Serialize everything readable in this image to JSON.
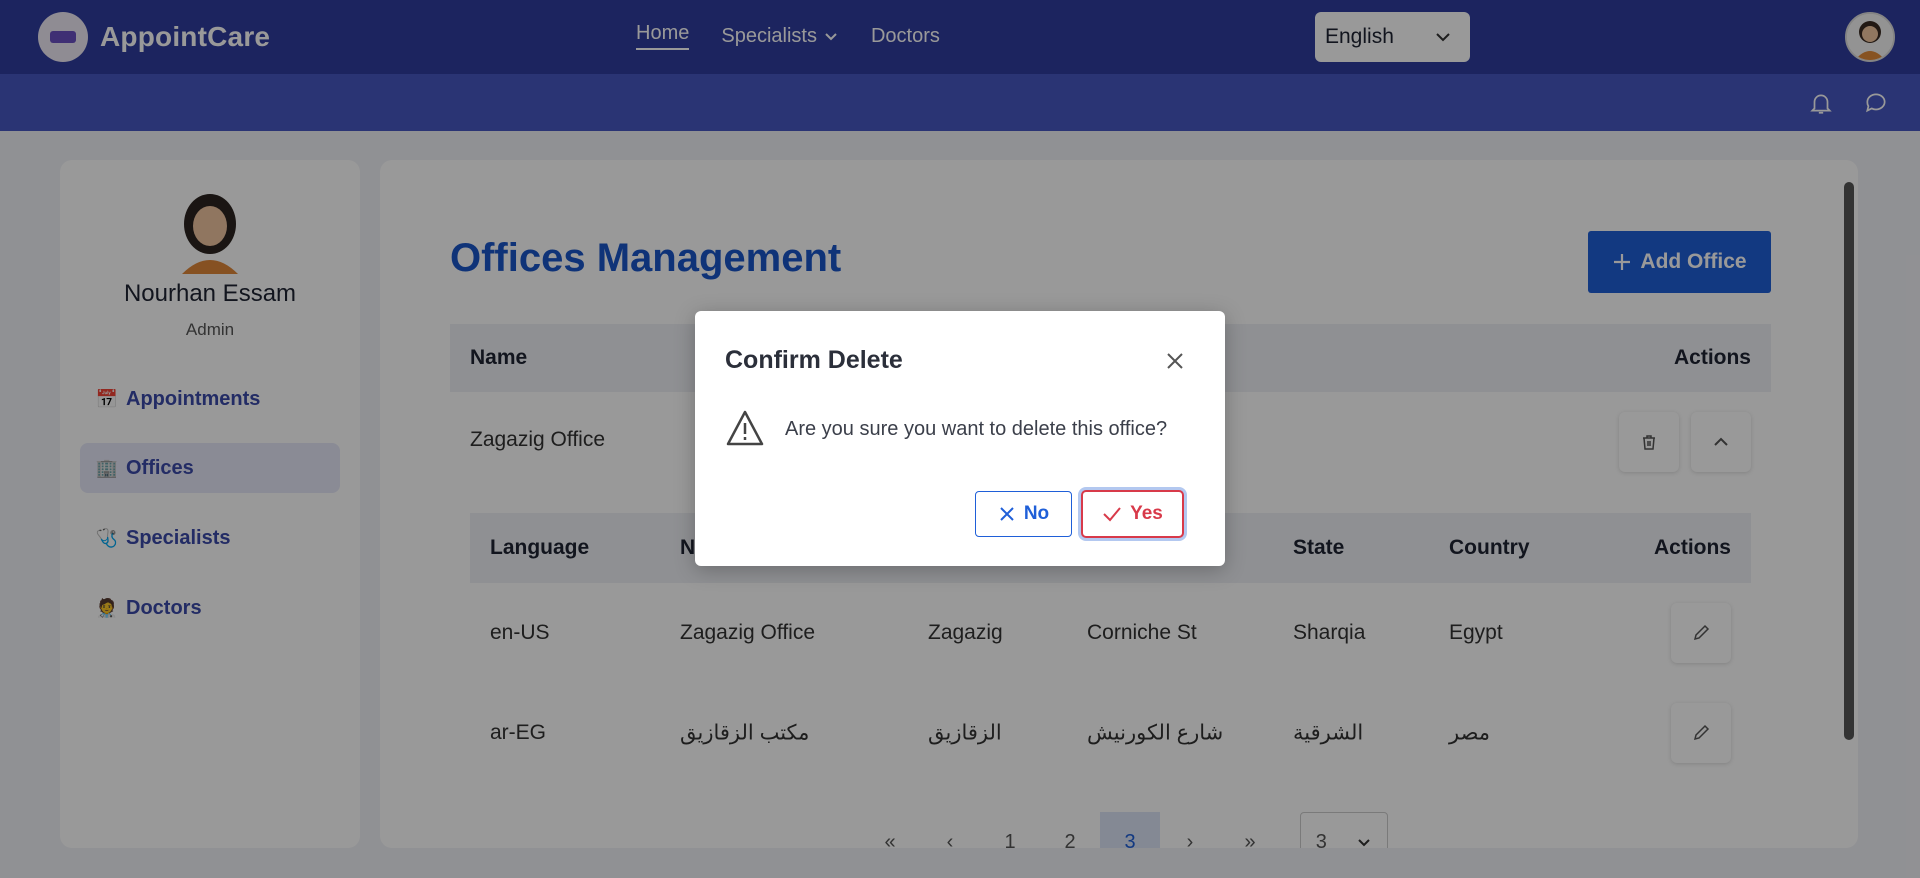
{
  "app": {
    "name": "AppointCare"
  },
  "nav": {
    "items": [
      {
        "label": "Home"
      },
      {
        "label": "Specialists"
      },
      {
        "label": "Doctors"
      }
    ]
  },
  "language": {
    "selected": "English"
  },
  "profile": {
    "name": "Nourhan Essam",
    "role": "Admin"
  },
  "sidebar": {
    "items": [
      {
        "label": "Appointments",
        "icon": "calendar-icon"
      },
      {
        "label": "Offices",
        "icon": "building-icon"
      },
      {
        "label": "Specialists",
        "icon": "stethoscope-icon"
      },
      {
        "label": "Doctors",
        "icon": "doctor-icon"
      }
    ]
  },
  "page": {
    "title": "Offices Management",
    "add_label": "Add Office"
  },
  "table": {
    "headers": {
      "name": "Name",
      "actions": "Actions"
    },
    "row": {
      "name": "Zagazig Office"
    }
  },
  "inner_table": {
    "headers": {
      "language": "Language",
      "name": "N",
      "state": "State",
      "country": "Country",
      "actions": "Actions"
    },
    "rows": [
      {
        "language": "en-US",
        "name": "Zagazig Office",
        "city": "Zagazig",
        "street": "Corniche St",
        "state": "Sharqia",
        "country": "Egypt"
      },
      {
        "language": "ar-EG",
        "name": "مكتب الزقازيق",
        "city": "الزقازيق",
        "street": "شارع الكورنيش",
        "state": "الشرقية",
        "country": "مصر"
      }
    ]
  },
  "pagination": {
    "first": "«",
    "prev": "‹",
    "pages": [
      "1",
      "2",
      "3"
    ],
    "current": "3",
    "next": "›",
    "last": "»",
    "page_size": "3"
  },
  "dialog": {
    "title": "Confirm Delete",
    "message": "Are you sure you want to delete this office?",
    "no_label": "No",
    "yes_label": "Yes"
  },
  "colors": {
    "primary": "#2f3c9e",
    "accent": "#1f5fd8",
    "danger": "#d83a4a"
  }
}
